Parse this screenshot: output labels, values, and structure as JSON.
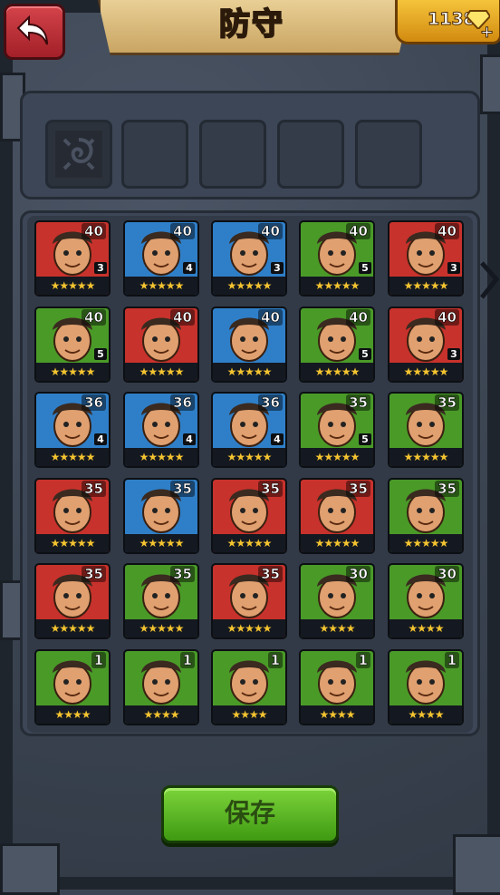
{
  "header": {
    "title": "防守",
    "gem_count": "1138"
  },
  "save_label": "保存",
  "heroes": [
    {
      "level": "40",
      "rank": "3",
      "stars": 5,
      "color": "#c8322c"
    },
    {
      "level": "40",
      "rank": "4",
      "stars": 5,
      "color": "#2f7fc8"
    },
    {
      "level": "40",
      "rank": "3",
      "stars": 5,
      "color": "#2f7fc8"
    },
    {
      "level": "40",
      "rank": "5",
      "stars": 5,
      "color": "#4a9a28"
    },
    {
      "level": "40",
      "rank": "3",
      "stars": 5,
      "color": "#c8322c"
    },
    {
      "level": "40",
      "rank": "5",
      "stars": 5,
      "color": "#4a9a28"
    },
    {
      "level": "40",
      "rank": "",
      "stars": 5,
      "color": "#c8322c"
    },
    {
      "level": "40",
      "rank": "",
      "stars": 5,
      "color": "#2f7fc8"
    },
    {
      "level": "40",
      "rank": "5",
      "stars": 5,
      "color": "#4a9a28"
    },
    {
      "level": "40",
      "rank": "3",
      "stars": 5,
      "color": "#c8322c"
    },
    {
      "level": "36",
      "rank": "4",
      "stars": 5,
      "color": "#2f7fc8"
    },
    {
      "level": "36",
      "rank": "4",
      "stars": 5,
      "color": "#2f7fc8"
    },
    {
      "level": "36",
      "rank": "4",
      "stars": 5,
      "color": "#2f7fc8"
    },
    {
      "level": "35",
      "rank": "5",
      "stars": 5,
      "color": "#4a9a28"
    },
    {
      "level": "35",
      "rank": "",
      "stars": 5,
      "color": "#4a9a28"
    },
    {
      "level": "35",
      "rank": "",
      "stars": 5,
      "color": "#c8322c"
    },
    {
      "level": "35",
      "rank": "",
      "stars": 5,
      "color": "#2f7fc8"
    },
    {
      "level": "35",
      "rank": "",
      "stars": 5,
      "color": "#c8322c"
    },
    {
      "level": "35",
      "rank": "",
      "stars": 5,
      "color": "#c8322c"
    },
    {
      "level": "35",
      "rank": "",
      "stars": 5,
      "color": "#4a9a28"
    },
    {
      "level": "35",
      "rank": "",
      "stars": 5,
      "color": "#c8322c"
    },
    {
      "level": "35",
      "rank": "",
      "stars": 5,
      "color": "#4a9a28"
    },
    {
      "level": "35",
      "rank": "",
      "stars": 5,
      "color": "#c8322c"
    },
    {
      "level": "30",
      "rank": "",
      "stars": 4,
      "color": "#4a9a28"
    },
    {
      "level": "30",
      "rank": "",
      "stars": 4,
      "color": "#4a9a28"
    },
    {
      "level": "1",
      "rank": "",
      "stars": 4,
      "color": "#4a9a28"
    },
    {
      "level": "1",
      "rank": "",
      "stars": 4,
      "color": "#4a9a28"
    },
    {
      "level": "1",
      "rank": "",
      "stars": 4,
      "color": "#4a9a28"
    },
    {
      "level": "1",
      "rank": "",
      "stars": 4,
      "color": "#4a9a28"
    },
    {
      "level": "1",
      "rank": "",
      "stars": 4,
      "color": "#4a9a28"
    }
  ]
}
